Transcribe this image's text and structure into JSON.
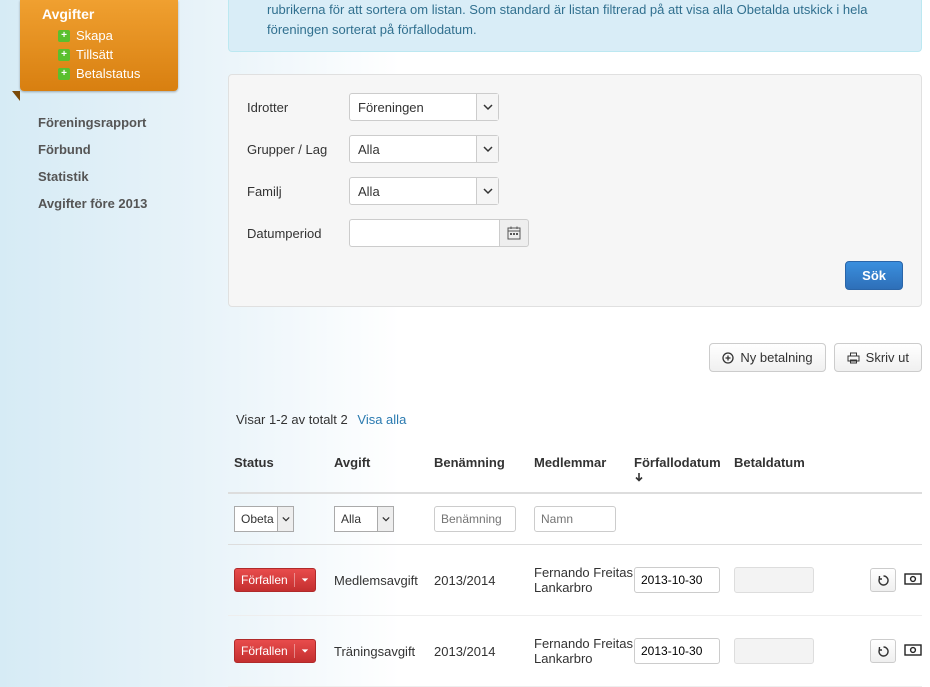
{
  "sidebar": {
    "active_title": "Avgifter",
    "sub": [
      {
        "label": "Skapa"
      },
      {
        "label": "Tillsätt"
      },
      {
        "label": "Betalstatus"
      }
    ],
    "links": [
      "Föreningsrapport",
      "Förbund",
      "Statistik",
      "Avgifter före 2013"
    ]
  },
  "info_text": "rubrikerna för att sortera om listan. Som standard är listan filtrerad på att visa alla Obetalda utskick i hela föreningen sorterat på förfallodatum.",
  "filters": {
    "idrotter_label": "Idrotter",
    "idrotter_value": "Föreningen",
    "grupper_label": "Grupper / Lag",
    "grupper_value": "Alla",
    "familj_label": "Familj",
    "familj_value": "Alla",
    "datum_label": "Datumperiod",
    "datum_value": "",
    "search": "Sök"
  },
  "actions": {
    "new_payment": "Ny betalning",
    "print": "Skriv ut"
  },
  "count": {
    "text": "Visar 1-2 av totalt 2",
    "show_all": "Visa alla"
  },
  "table": {
    "headers": {
      "status": "Status",
      "avgift": "Avgift",
      "benamning": "Benämning",
      "medlemmar": "Medlemmar",
      "forfall": "Förfallodatum",
      "betaldatum": "Betaldatum"
    },
    "col_filters": {
      "status": "Obeta",
      "avgift": "Alla",
      "benamning_ph": "Benämning",
      "namn_ph": "Namn"
    },
    "rows": [
      {
        "status": "Förfallen",
        "avgift": "Medlemsavgift",
        "benamning": "2013/2014",
        "medlem": "Fernando Freitas Lankarbro",
        "forfall": "2013-10-30",
        "betal": ""
      },
      {
        "status": "Förfallen",
        "avgift": "Träningsavgift",
        "benamning": "2013/2014",
        "medlem": "Fernando Freitas Lankarbro",
        "forfall": "2013-10-30",
        "betal": ""
      }
    ]
  }
}
